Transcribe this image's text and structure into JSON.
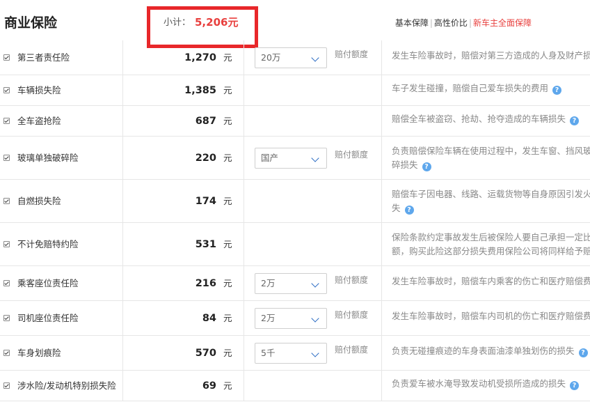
{
  "header": {
    "title": "商业保险",
    "subtotal_label": "小计：",
    "subtotal_value": "5,206元",
    "links": [
      {
        "label": "基本保障",
        "highlight": false
      },
      {
        "label": "高性价比",
        "highlight": false
      },
      {
        "label": "新车主全面保障",
        "highlight": true
      }
    ]
  },
  "accent_color": "#e8403e",
  "highlight_box_color": "#e8272a",
  "help_icon_color": "#5ea7ec",
  "rows": [
    {
      "name": "第三者责任险",
      "price": "1,270",
      "unit": "元",
      "select": "20万",
      "pf": "赔付额度",
      "desc": [
        "发生车险事故时，赔偿对第三方造成的人身及财产损失"
      ],
      "help": false
    },
    {
      "name": "车辆损失险",
      "price": "1,385",
      "unit": "元",
      "select": null,
      "pf": null,
      "desc": [
        "车子发生碰撞，赔偿自己爱车损失的费用"
      ],
      "help": true
    },
    {
      "name": "全车盗抢险",
      "price": "687",
      "unit": "元",
      "select": null,
      "pf": null,
      "desc": [
        "赔偿全车被盗窃、抢劫、抢夺造成的车辆损失"
      ],
      "help": true
    },
    {
      "name": "玻璃单独破碎险",
      "price": "220",
      "unit": "元",
      "select": "国产",
      "pf": "赔付额度",
      "desc": [
        "负责赔偿保险车辆在使用过程中，发生车窗、挡风玻璃",
        "碎损失"
      ],
      "help": true
    },
    {
      "name": "自燃损失险",
      "price": "174",
      "unit": "元",
      "select": null,
      "pf": null,
      "desc": [
        "赔偿车子因电器、线路、运载货物等自身原因引发火灾",
        "失"
      ],
      "help": true
    },
    {
      "name": "不计免赔特约险",
      "price": "531",
      "unit": "元",
      "select": null,
      "pf": null,
      "desc": [
        "保险条款约定事故发生后被保险人要自己承担一定比例",
        "额，购买此险这部分损失费用保险公司将同样给予赔偿"
      ],
      "help": false
    },
    {
      "name": "乘客座位责任险",
      "price": "216",
      "unit": "元",
      "select": "2万",
      "pf": "赔付额度",
      "desc": [
        "发生车险事故时，赔偿车内乘客的伤亡和医疗赔偿费用"
      ],
      "help": false
    },
    {
      "name": "司机座位责任险",
      "price": "84",
      "unit": "元",
      "select": "2万",
      "pf": "赔付额度",
      "desc": [
        "发生车险事故时，赔偿车内司机的伤亡和医疗赔偿费用"
      ],
      "help": false
    },
    {
      "name": "车身划痕险",
      "price": "570",
      "unit": "元",
      "select": "5千",
      "pf": "赔付额度",
      "desc": [
        "负责无碰撞痕迹的车身表面油漆单独划伤的损失"
      ],
      "help": true
    },
    {
      "name": "涉水险/发动机特别损失险",
      "price": "69",
      "unit": "元",
      "select": null,
      "pf": null,
      "desc": [
        "负责爱车被水淹导致发动机受损所造成的损失"
      ],
      "help": true
    }
  ]
}
